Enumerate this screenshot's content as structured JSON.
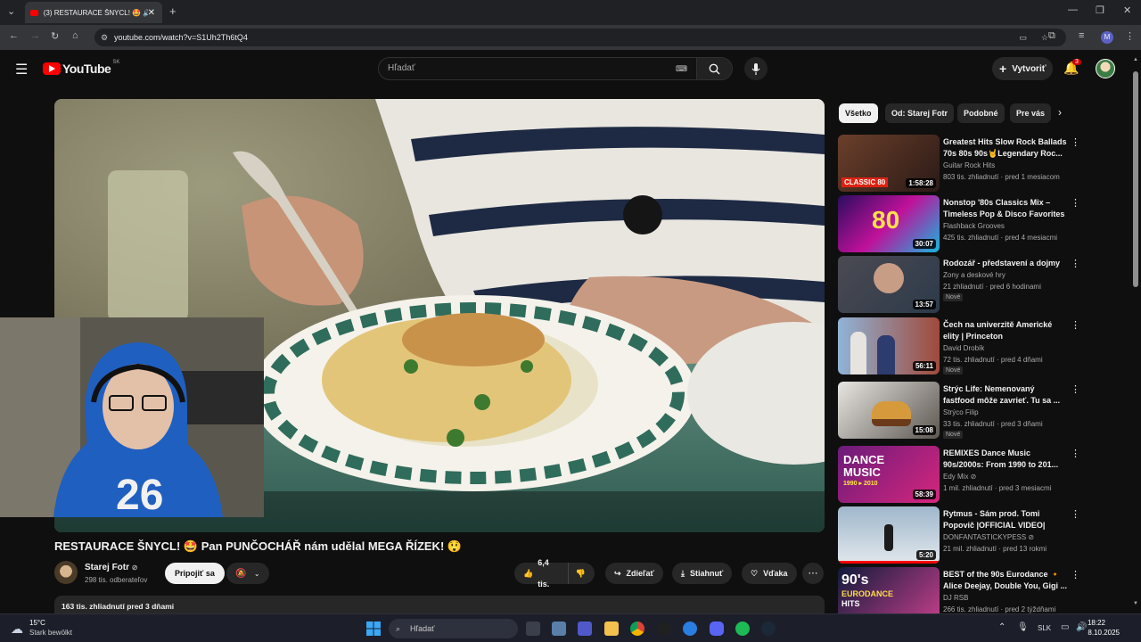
{
  "browser": {
    "tab_title": "(3) RESTAURACE ŠNYCL! 🤩 🔊",
    "url": "youtube.com/watch?v=S1Uh2Th6tQ4"
  },
  "header": {
    "logo": "YouTube",
    "region": "SK",
    "search_placeholder": "Hľadať",
    "create_label": "Vytvoriť",
    "notifications_count": "3"
  },
  "video": {
    "title": "RESTAURACE ŠNYCL! 🤩 Pan PUNČOCHÁŘ nám udělal MEGA ŘÍZEK! 😲",
    "channel": "Starej Fotr",
    "subscribers": "298 tis. odberateľov",
    "subscribe_label": "Pripojiť sa",
    "likes": "6,4 tis.",
    "share_label": "Zdieľať",
    "download_label": "Stiahnuť",
    "thanks_label": "Vďaka",
    "views_line": "163 tis. zhliadnutí  pred 3 dňami"
  },
  "chips": [
    "Všetko",
    "Od: Starej Fotr",
    "Podobné",
    "Pre vás"
  ],
  "recommendations": [
    {
      "title": "Greatest Hits Slow Rock Ballads 70s 80s 90s🤘Legendary Roc...",
      "channel": "Guitar Rock Hits",
      "meta": "803 tis. zhliadnutí · pred 1 mesiacom",
      "duration": "1:58:28",
      "badge": ""
    },
    {
      "title": "Nonstop '80s Classics Mix – Timeless Pop & Disco Favorites",
      "channel": "Flashback Grooves",
      "meta": "425 tis. zhliadnutí · pred 4 mesiacmi",
      "duration": "30:07",
      "badge": ""
    },
    {
      "title": "Rodozář - představení a dojmy",
      "channel": "Zony a deskové hry",
      "meta": "21 zhliadnutí · pred 6 hodinami",
      "duration": "13:57",
      "badge": "Nové"
    },
    {
      "title": "Čech na univerzitě Americké elity | Princeton",
      "channel": "David Drobík",
      "meta": "72 tis. zhliadnutí · pred 4 dňami",
      "duration": "56:11",
      "badge": "Nové"
    },
    {
      "title": "Strýc Life: Nemenovaný fastfood môže zavrieť. Tu sa ...",
      "channel": "Strýco Filip",
      "meta": "33 tis. zhliadnutí · pred 3 dňami",
      "duration": "15:08",
      "badge": "Nové"
    },
    {
      "title": "REMIXES Dance Music 90s/2000s: From 1990 to 201...",
      "channel": "Edy Mix ⊘",
      "meta": "1 mil. zhliadnutí · pred 3 mesiacmi",
      "duration": "58:39",
      "badge": ""
    },
    {
      "title": "Rytmus - Sám prod. Tomi Popovič |OFFICIAL VIDEO|",
      "channel": "DONFANTASTICKYPESS ⊘",
      "meta": "21 mil. zhliadnutí · pred 13 rokmi",
      "duration": "5:20",
      "badge": ""
    },
    {
      "title": "BEST of the 90s Eurodance 🔸 Alice Deejay, Double You, Gigi ...",
      "channel": "DJ RSB",
      "meta": "266 tis. zhliadnutí · pred 2 týždňami",
      "duration": "",
      "badge": ""
    }
  ],
  "thumb_text": {
    "t1": "CLASSIC 80",
    "t2": "80",
    "t6a": "DANCE",
    "t6b": "MUSIC",
    "t6c": "1990 ▸ 2010",
    "t8a": "90's",
    "t8b": "EURODANCE",
    "t8c": "HITS"
  },
  "taskbar": {
    "weather_temp": "15°C",
    "weather_desc": "Stark bewölkt",
    "search_placeholder": "Hľadať",
    "lang": "SLK",
    "time": "18:22",
    "date": "8.10.2025"
  },
  "colors": {
    "yt_red": "#ff0000",
    "bg": "#0f0f0f",
    "chip_bg": "#272727"
  }
}
